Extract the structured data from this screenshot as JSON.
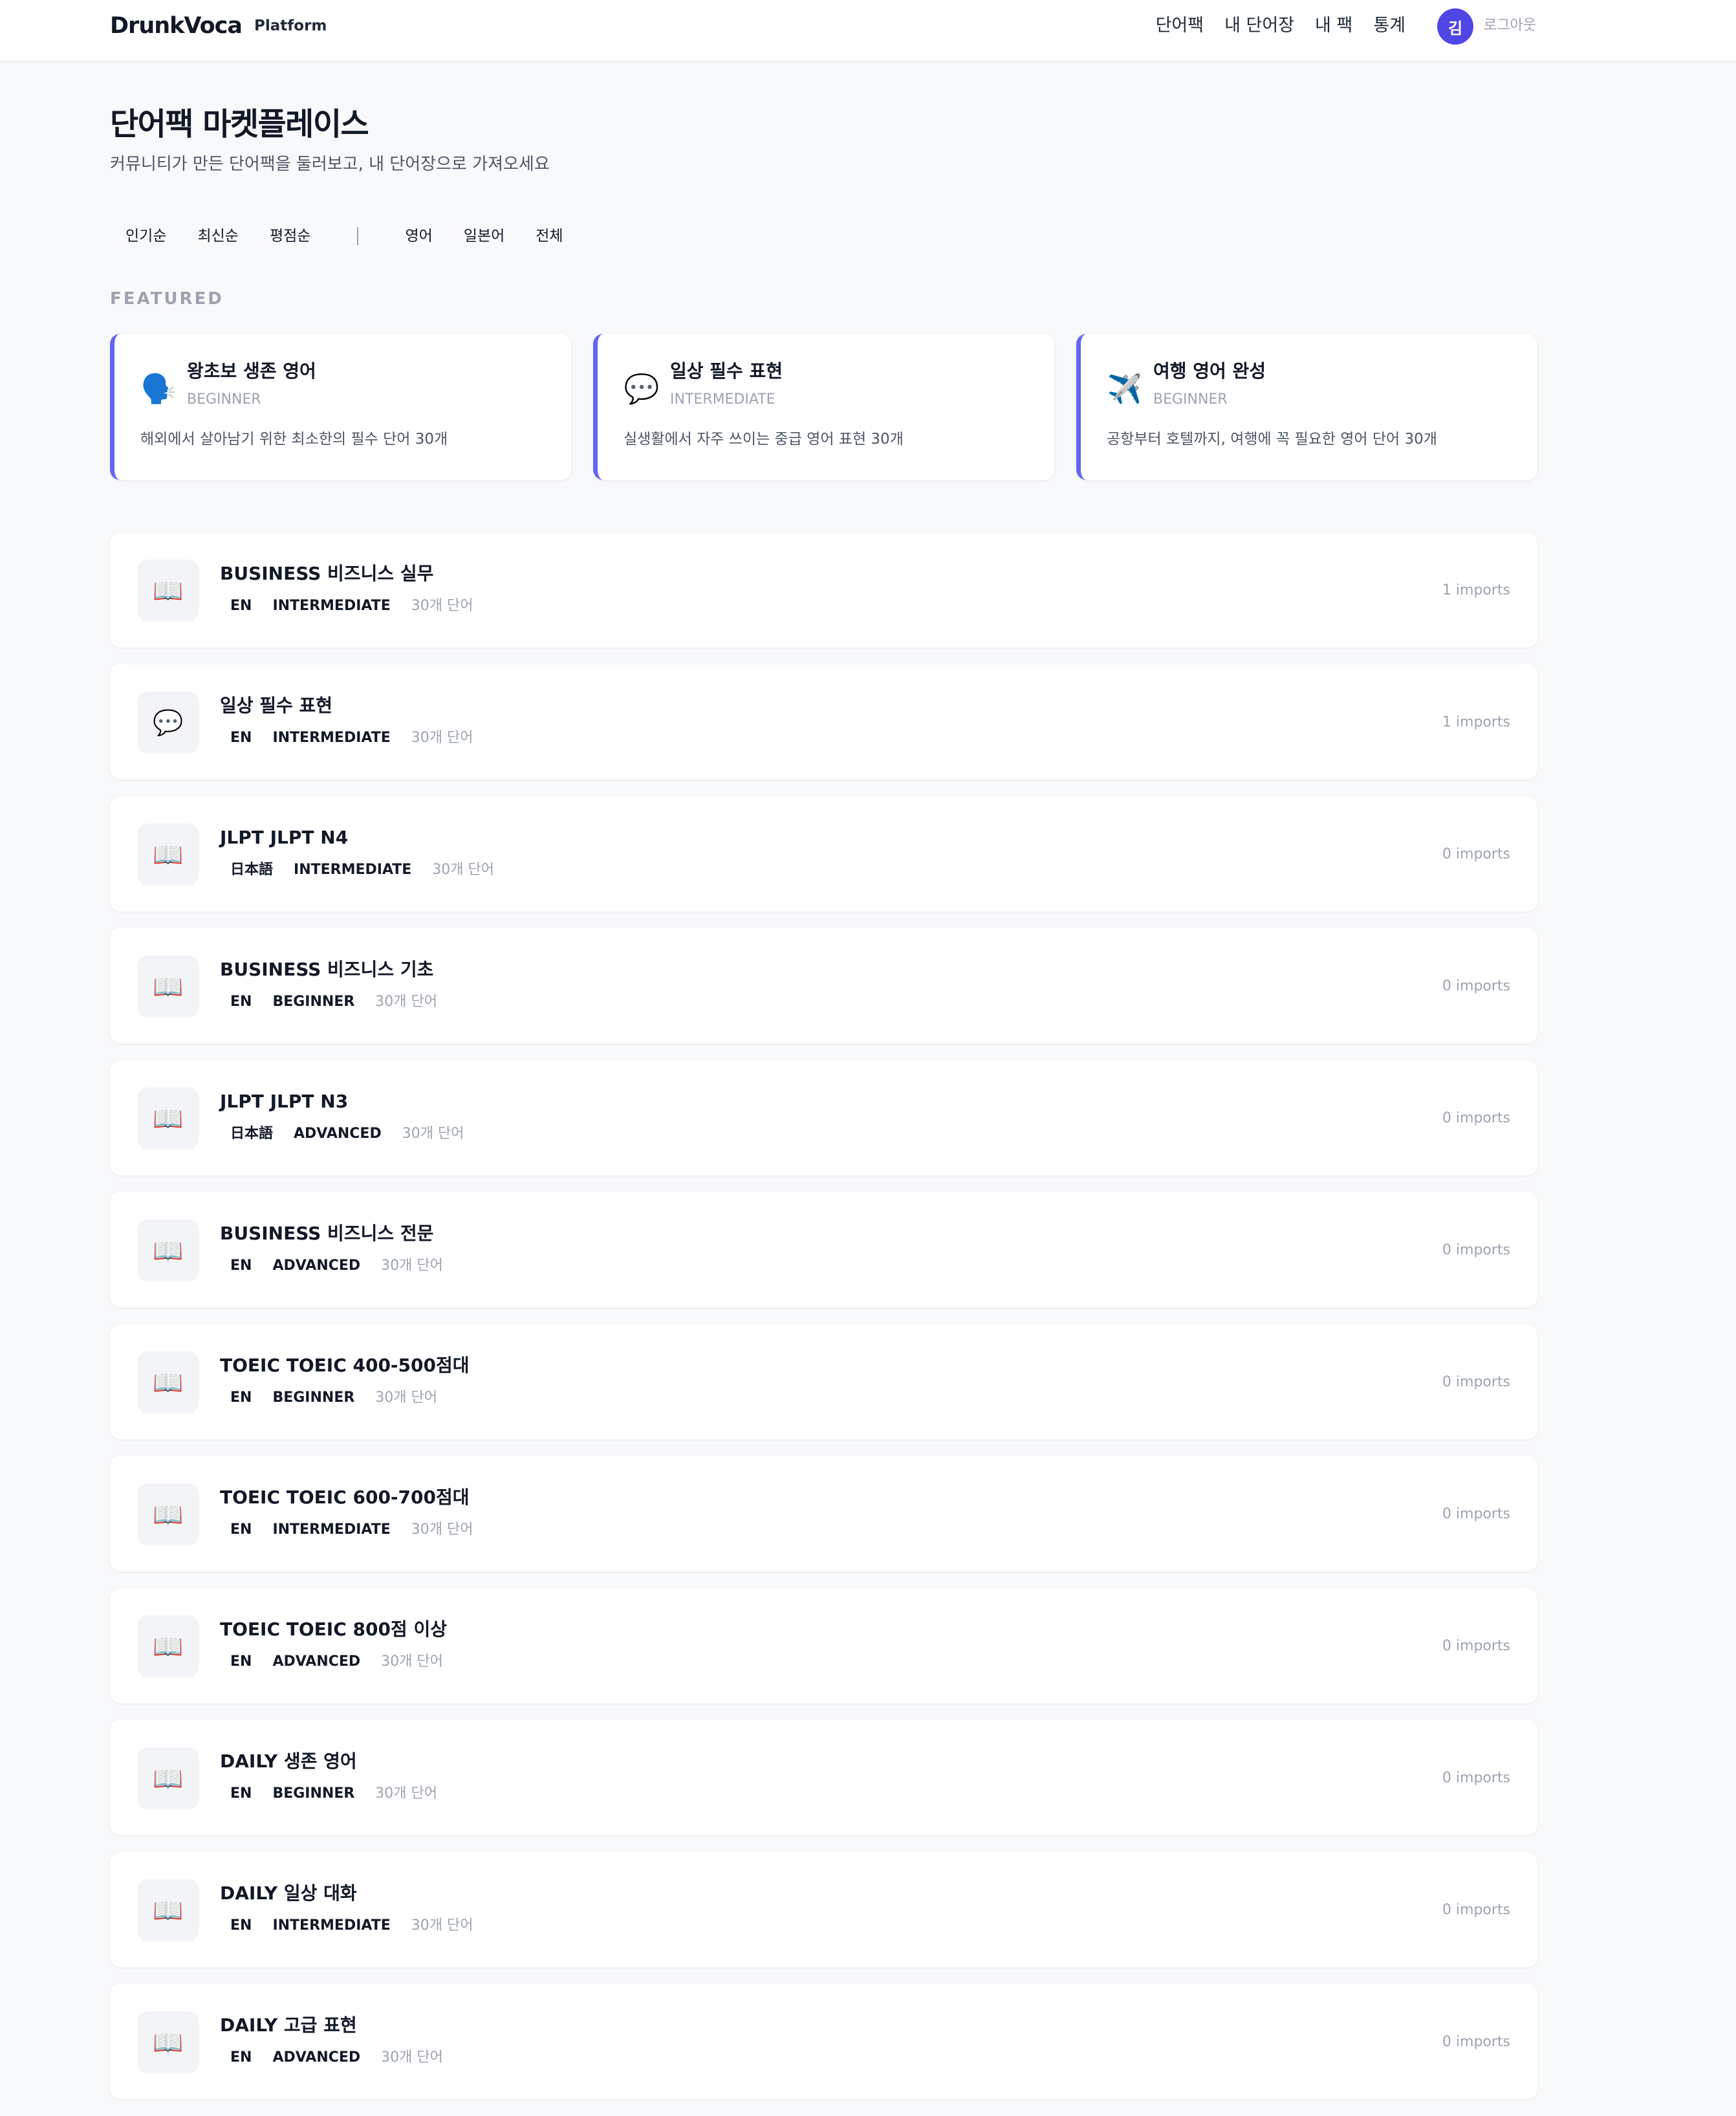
{
  "header": {
    "brand": "DrunkVoca",
    "brand_sub": "Platform",
    "nav": [
      "단어팩",
      "내 단어장",
      "내 팩",
      "통계"
    ],
    "avatar_initial": "김",
    "logout": "로그아웃"
  },
  "page": {
    "title": "단어팩 마켓플레이스",
    "subtitle": "커뮤니티가 만든 단어팩을 둘러보고, 내 단어장으로 가져오세요"
  },
  "filters": {
    "sort": [
      "인기순",
      "최신순",
      "평점순"
    ],
    "language": [
      "영어",
      "일본어",
      "전체"
    ]
  },
  "featured": {
    "label": "FEATURED",
    "cards": [
      {
        "icon": "speaking-head-icon",
        "glyph": "🗣️",
        "title": "왕초보 생존 영어",
        "level": "BEGINNER",
        "desc": "해외에서 살아남기 위한 최소한의 필수 단어 30개"
      },
      {
        "icon": "speech-bubble-icon",
        "glyph": "💬",
        "title": "일상 필수 표현",
        "level": "INTERMEDIATE",
        "desc": "실생활에서 자주 쓰이는 중급 영어 표현 30개"
      },
      {
        "icon": "airplane-icon",
        "glyph": "✈️",
        "title": "여행 영어 완성",
        "level": "BEGINNER",
        "desc": "공항부터 호텔까지, 여행에 꼭 필요한 영어 단어 30개"
      }
    ]
  },
  "packs": [
    {
      "icon": "book-icon",
      "glyph": "📖",
      "title": "BUSINESS 비즈니스 실무",
      "lang": "EN",
      "level": "INTERMEDIATE",
      "words": "30개 단어",
      "imports": "1 imports"
    },
    {
      "icon": "speech-bubble-icon",
      "glyph": "💬",
      "title": "일상 필수 표현",
      "lang": "EN",
      "level": "INTERMEDIATE",
      "words": "30개 단어",
      "imports": "1 imports"
    },
    {
      "icon": "book-icon",
      "glyph": "📖",
      "title": "JLPT JLPT N4",
      "lang": "日本語",
      "level": "INTERMEDIATE",
      "words": "30개 단어",
      "imports": "0 imports"
    },
    {
      "icon": "book-icon",
      "glyph": "📖",
      "title": "BUSINESS 비즈니스 기초",
      "lang": "EN",
      "level": "BEGINNER",
      "words": "30개 단어",
      "imports": "0 imports"
    },
    {
      "icon": "book-icon",
      "glyph": "📖",
      "title": "JLPT JLPT N3",
      "lang": "日本語",
      "level": "ADVANCED",
      "words": "30개 단어",
      "imports": "0 imports"
    },
    {
      "icon": "book-icon",
      "glyph": "📖",
      "title": "BUSINESS 비즈니스 전문",
      "lang": "EN",
      "level": "ADVANCED",
      "words": "30개 단어",
      "imports": "0 imports"
    },
    {
      "icon": "book-icon",
      "glyph": "📖",
      "title": "TOEIC TOEIC 400-500점대",
      "lang": "EN",
      "level": "BEGINNER",
      "words": "30개 단어",
      "imports": "0 imports"
    },
    {
      "icon": "book-icon",
      "glyph": "📖",
      "title": "TOEIC TOEIC 600-700점대",
      "lang": "EN",
      "level": "INTERMEDIATE",
      "words": "30개 단어",
      "imports": "0 imports"
    },
    {
      "icon": "book-icon",
      "glyph": "📖",
      "title": "TOEIC TOEIC 800점 이상",
      "lang": "EN",
      "level": "ADVANCED",
      "words": "30개 단어",
      "imports": "0 imports"
    },
    {
      "icon": "book-icon",
      "glyph": "📖",
      "title": "DAILY 생존 영어",
      "lang": "EN",
      "level": "BEGINNER",
      "words": "30개 단어",
      "imports": "0 imports"
    },
    {
      "icon": "book-icon",
      "glyph": "📖",
      "title": "DAILY 일상 대화",
      "lang": "EN",
      "level": "INTERMEDIATE",
      "words": "30개 단어",
      "imports": "0 imports"
    },
    {
      "icon": "book-icon",
      "glyph": "📖",
      "title": "DAILY 고급 표현",
      "lang": "EN",
      "level": "ADVANCED",
      "words": "30개 단어",
      "imports": "0 imports"
    }
  ]
}
